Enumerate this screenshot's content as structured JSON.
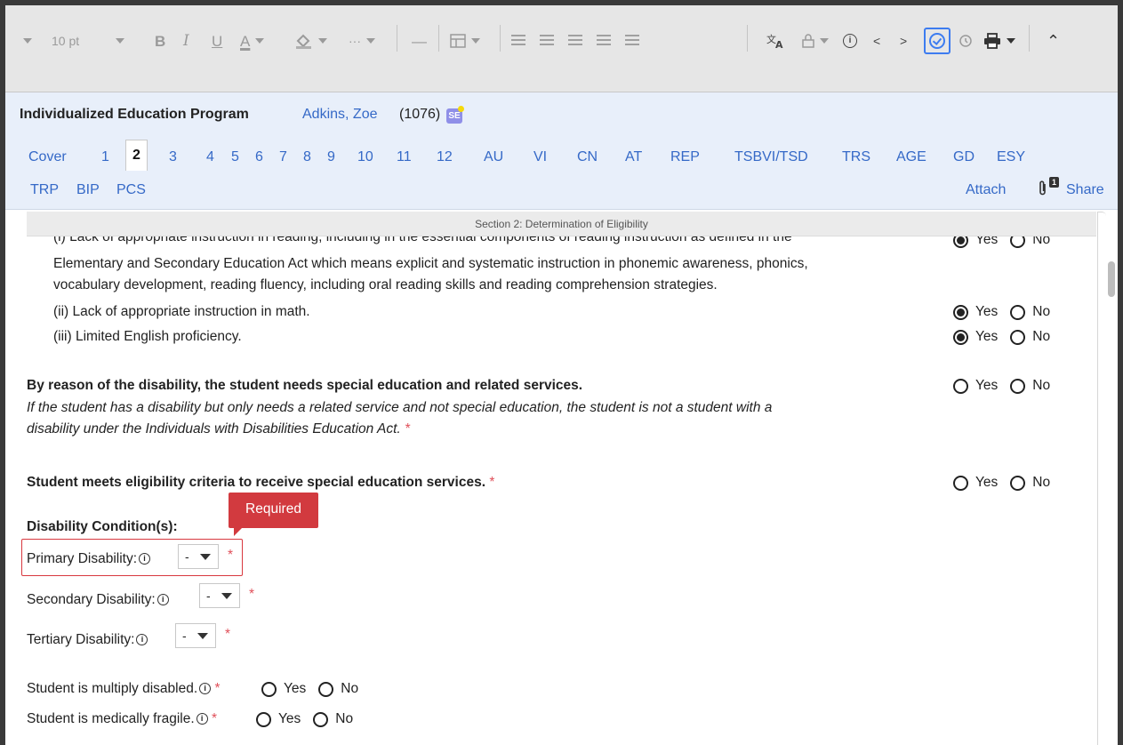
{
  "toolbar": {
    "font_size": "10 pt",
    "bold": "B",
    "italic": "I",
    "underline": "U",
    "font_color": "A",
    "more": "···",
    "hr": "—",
    "prev": "<",
    "next": ">",
    "info": "i",
    "collapse": "⌃",
    "icons": [
      "caret-icon",
      "bold-icon",
      "italic-icon",
      "underline-icon",
      "font-color-icon",
      "fill-color-icon",
      "more-icon",
      "horizontal-rule-icon",
      "table-icon",
      "numbered-list-icon",
      "bullet-list-icon",
      "indent-icon",
      "outdent-icon",
      "align-icon",
      "translate-icon",
      "lock-icon",
      "info-icon",
      "prev-icon",
      "next-icon",
      "check-circle-icon",
      "history-icon",
      "print-icon",
      "collapse-icon"
    ]
  },
  "header": {
    "title": "Individualized Education Program",
    "student": "Adkins, Zoe",
    "student_id": "(1076)",
    "badge": "SE",
    "tabs": [
      "Cover",
      "1",
      "2",
      "3",
      "4",
      "5",
      "6",
      "7",
      "8",
      "9",
      "10",
      "11",
      "12",
      "AU",
      "VI",
      "CN",
      "AT",
      "REP",
      "TSBVI/TSD",
      "TRS",
      "AGE",
      "GD",
      "ESY"
    ],
    "tabs_row2": [
      "TRP",
      "BIP",
      "PCS"
    ],
    "active_tab": "2",
    "attach": "Attach",
    "attach_count": "1",
    "share": "Share"
  },
  "content": {
    "section_banner": "Section 2: Determination of Eligibility",
    "lines": {
      "i_line1": "(i) Lack of appropriate instruction in reading, including in the essential components of reading instruction as defined in the",
      "i_line2": "Elementary and Secondary Education Act which means explicit and systematic instruction in phonemic awareness, phonics,",
      "i_line3": "vocabulary development, reading fluency, including oral reading skills and reading comprehension strategies.",
      "ii": "(ii) Lack of appropriate instruction in math.",
      "iii": "(iii) Limited English proficiency.",
      "need_bold": "By reason of the disability, the student needs special education and related services.",
      "need_italic1": "If the student has a disability but only needs a related service and not special education, the student is not a student with a",
      "need_italic2": "disability under the Individuals with Disabilities Education Act.",
      "meets": "Student meets eligibility criteria to receive special education services.",
      "disability_heading": "Disability Condition(s):",
      "primary": "Primary Disability:",
      "secondary": "Secondary Disability:",
      "tertiary": "Tertiary Disability:",
      "multiply": "Student is multiply disabled.",
      "fragile": "Student is medically fragile."
    },
    "asterisk": "*",
    "yes": "Yes",
    "no": "No",
    "select_value": "-",
    "required_tooltip": "Required",
    "answers": {
      "i": "Yes",
      "ii": "Yes",
      "iii": "Yes",
      "need": "",
      "meets": "",
      "multiply": "",
      "fragile": ""
    }
  }
}
